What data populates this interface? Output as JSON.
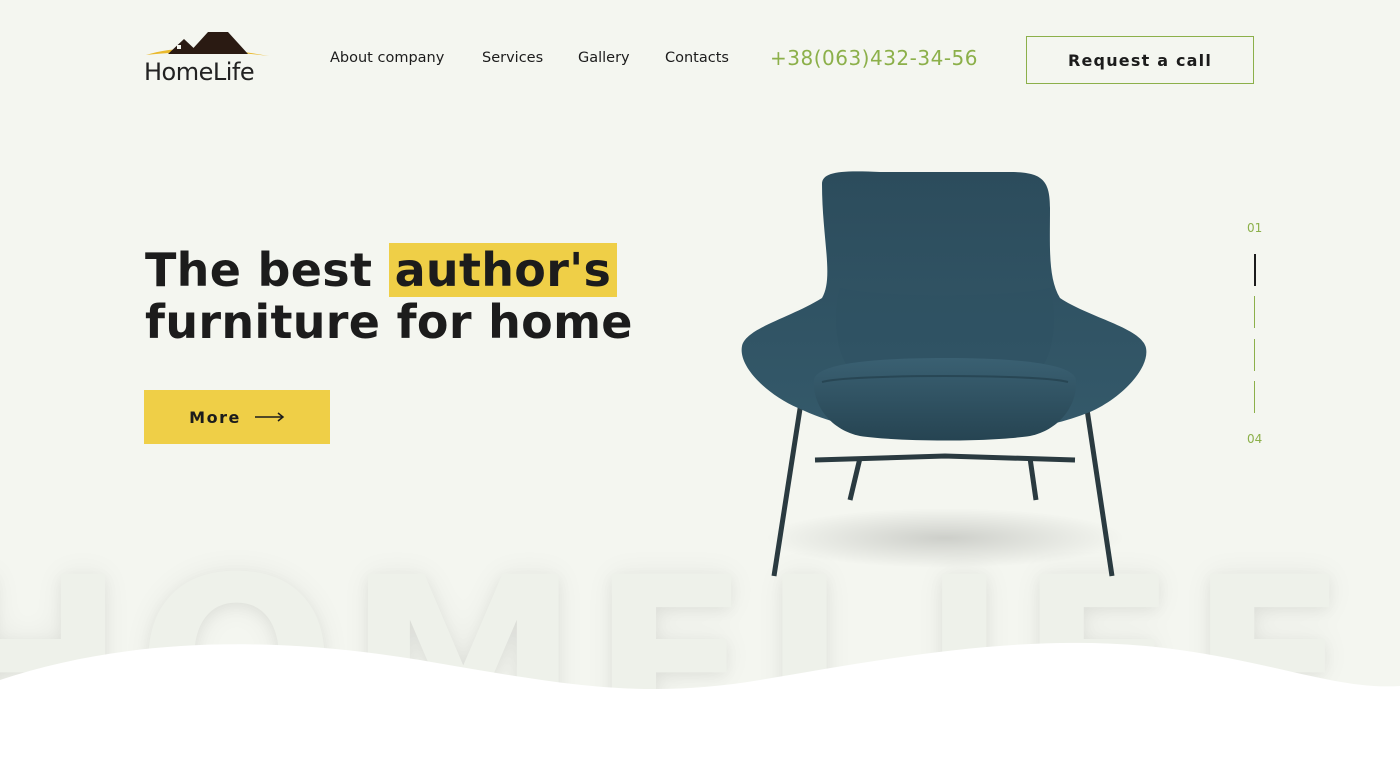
{
  "brand": {
    "name": "HomeLife",
    "background_word": "HOMELIFE"
  },
  "nav": [
    {
      "label": "About company"
    },
    {
      "label": "Services"
    },
    {
      "label": "Gallery"
    },
    {
      "label": "Contacts"
    }
  ],
  "phone": "+38(063)432-34-56",
  "call_button": "Request a call",
  "hero": {
    "title_part1": "The best ",
    "title_highlight": "author's",
    "title_line2": "furniture for home",
    "more_button": "More"
  },
  "slider": {
    "first": "01",
    "last": "04",
    "count": 4,
    "active_index": 0
  },
  "colors": {
    "background": "#f4f6f0",
    "accent_yellow": "#efcf47",
    "accent_green": "#8cb04a",
    "text": "#1c1c1c",
    "chair": "#2f5060"
  }
}
